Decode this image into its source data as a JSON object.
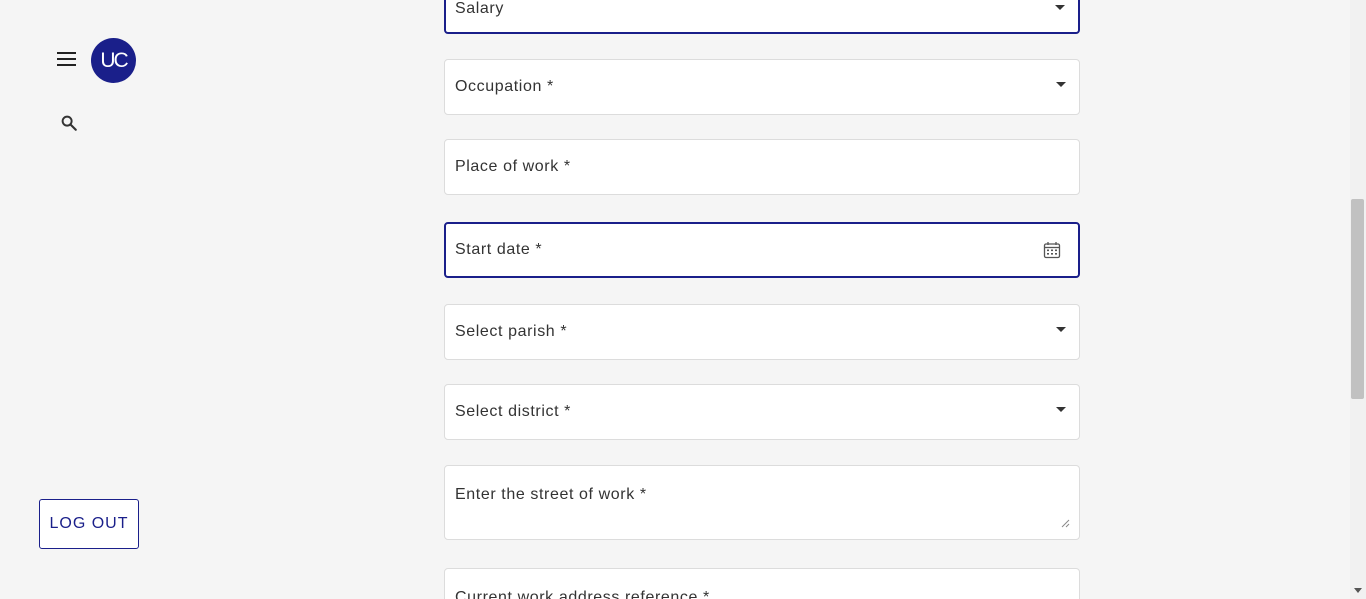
{
  "sidebar": {
    "avatar_initials": "UC",
    "logout_label": "LOG OUT",
    "menu_icon": "hamburger-menu-icon",
    "search_icon": "search-icon"
  },
  "form": {
    "salary": "Salary",
    "occupation": "Occupation *",
    "place_of_work": "Place of work *",
    "start_date": "Start date *",
    "parish": "Select parish *",
    "district": "Select district *",
    "street_of_work": "Enter the street of work *",
    "work_address_reference": "Current work address reference *"
  },
  "colors": {
    "accent": "#1a1f8a",
    "background": "#f5f5f5",
    "field_border": "#dcdcdc"
  }
}
